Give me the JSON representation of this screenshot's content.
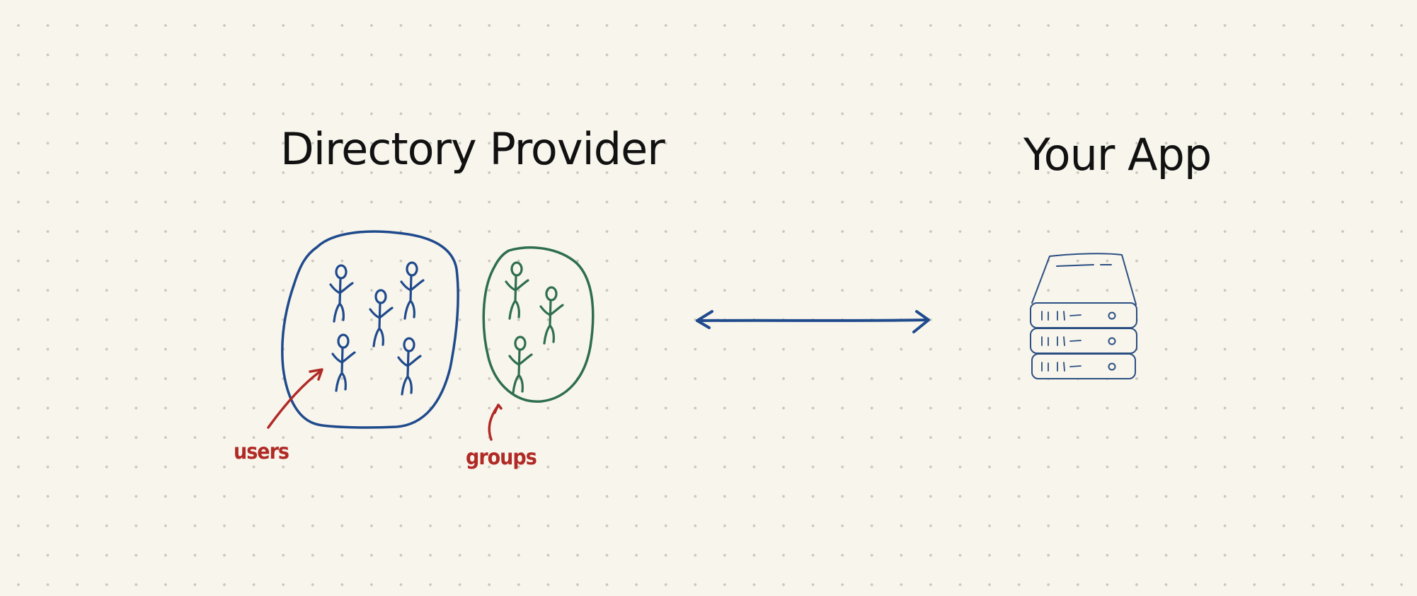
{
  "diagram": {
    "left_title": "Directory Provider",
    "right_title": "Your App",
    "annotations": {
      "users": "users",
      "groups": "groups"
    },
    "connector": "bidirectional-arrow",
    "users_count": 5,
    "groups_count": 3,
    "server_units": 3,
    "colors": {
      "background": "#f8f5ec",
      "grid_dots": "#c9c6bd",
      "ink": "#111111",
      "users": "#1f4a8c",
      "groups": "#2e6e4f",
      "annotation": "#b02a26",
      "server": "#2b4f82"
    }
  }
}
